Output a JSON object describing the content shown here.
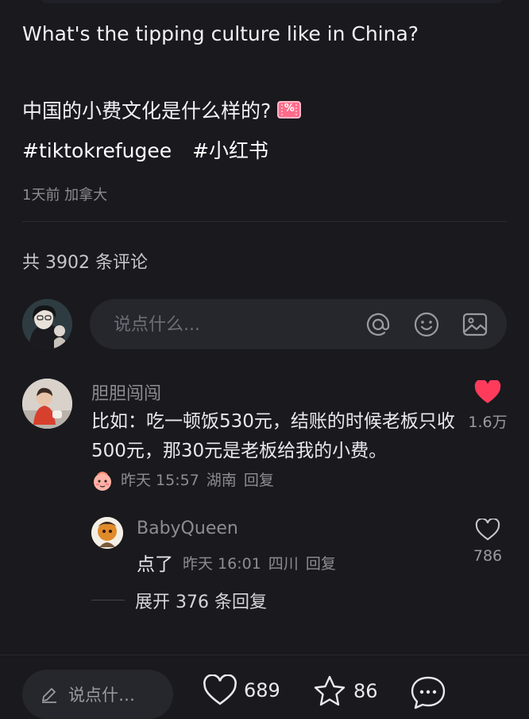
{
  "post": {
    "title_en": "What's the tipping culture like in China?",
    "title_zh": "中国的小费文化是什么样的?",
    "badge_text": "%",
    "tags": [
      "#tiktokrefugee",
      "#小红书"
    ],
    "meta": "1天前 加拿大"
  },
  "comments_header": {
    "count_text": "共 3902 条评论"
  },
  "comment_input": {
    "placeholder": "说点什么..."
  },
  "comment": {
    "user": "胆胆闯闯",
    "text": "比如：吃一顿饭530元，结账的时候老板只收500元，那30元是老板给我的小费。",
    "time": "昨天 15:57",
    "location": "湖南",
    "reply_label": "回复",
    "likes": "1.6万",
    "liked": true
  },
  "reply": {
    "user": "BabyQueen",
    "text": "点了",
    "time": "昨天 16:01",
    "location": "四川",
    "reply_label": "回复",
    "likes": "786"
  },
  "expand_text": "展开 376 条回复",
  "bottom_bar": {
    "input_placeholder": "说点什…",
    "like_count": "689",
    "star_count": "86"
  },
  "colors": {
    "background": "#19191e",
    "heart_red": "#ff3b5c",
    "muted_text": "#8c8c93"
  }
}
